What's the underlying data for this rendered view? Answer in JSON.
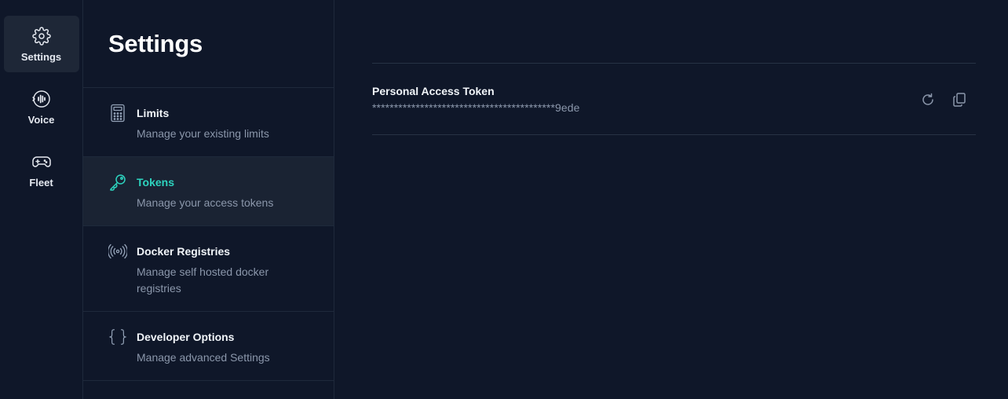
{
  "rail": {
    "items": [
      {
        "label": "Settings",
        "icon": "gear-icon",
        "active": true
      },
      {
        "label": "Voice",
        "icon": "voice-icon",
        "active": false
      },
      {
        "label": "Fleet",
        "icon": "gamepad-icon",
        "active": false
      }
    ]
  },
  "menu": {
    "title": "Settings",
    "items": [
      {
        "title": "Limits",
        "desc": "Manage your existing limits",
        "icon": "calculator-icon"
      },
      {
        "title": "Tokens",
        "desc": "Manage your access tokens",
        "icon": "key-icon",
        "active": true
      },
      {
        "title": "Docker Registries",
        "desc": "Manage self hosted docker registries",
        "icon": "broadcast-icon"
      },
      {
        "title": "Developer Options",
        "desc": "Manage advanced Settings",
        "icon": "braces-icon"
      }
    ]
  },
  "token": {
    "label": "Personal Access Token",
    "value": "******************************************9ede",
    "actions": [
      "refresh-icon",
      "copy-icon"
    ]
  },
  "colors": {
    "background": "#0f1729",
    "accent": "#2dd4bf",
    "muted": "#8b97ab",
    "active_bg": "#1a2333"
  }
}
